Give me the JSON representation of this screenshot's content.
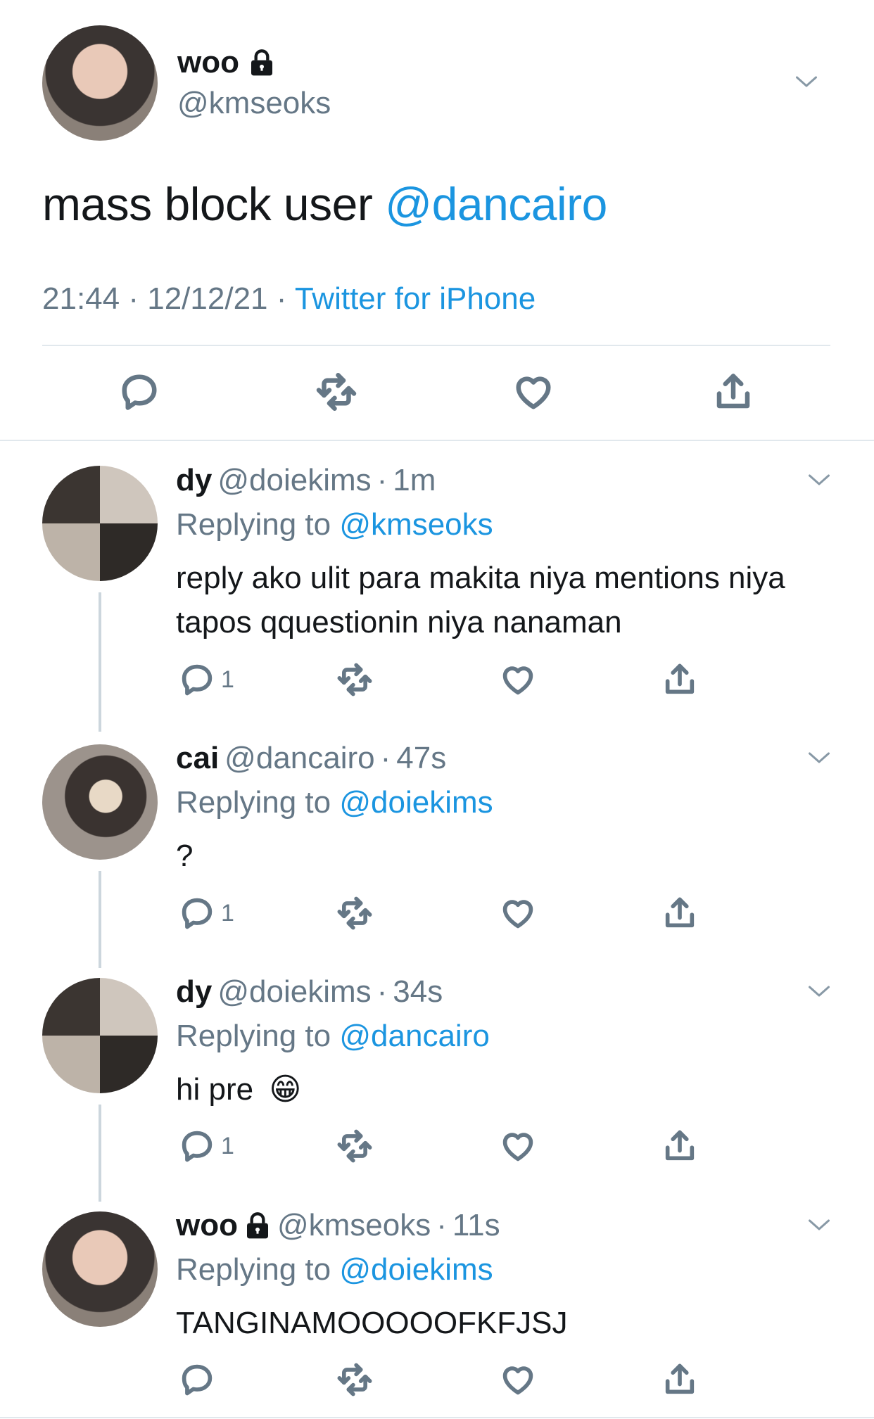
{
  "main_tweet": {
    "author_name": "woo",
    "author_handle": "@kmseoks",
    "text_prefix": "mass block user ",
    "text_mention": "@dancairo",
    "time": "21:44",
    "date": "12/12/21",
    "sep": "·",
    "source": "Twitter for iPhone",
    "avatar_icon": "avatar-photo",
    "lock_icon": "lock-icon"
  },
  "replies": [
    {
      "name": "dy",
      "handle": "@doiekims",
      "sep": "·",
      "time": "1m",
      "replying_prefix": "Replying to",
      "replying_to": "@kmseoks",
      "text": "reply ako ulit para makita niya mentions niya tapos qquestionin niya nanaman",
      "reply_count": "1"
    },
    {
      "name": "cai",
      "handle": "@dancairo",
      "sep": "·",
      "time": "47s",
      "replying_prefix": "Replying to",
      "replying_to": "@doiekims",
      "text": "?",
      "reply_count": "1"
    },
    {
      "name": "dy",
      "handle": "@doiekims",
      "sep": "·",
      "time": "34s",
      "replying_prefix": "Replying to",
      "replying_to": "@dancairo",
      "text": "hi pre",
      "emoji": "😁",
      "reply_count": "1"
    },
    {
      "name": "woo",
      "handle": "@kmseoks",
      "sep": "·",
      "time": "11s",
      "replying_prefix": "Replying to",
      "replying_to": "@doiekims",
      "text": "TANGINAMOOOOOFKFJSJ",
      "reply_count": ""
    }
  ],
  "colors": {
    "link": "#1b95e0",
    "secondary": "#657786",
    "divider": "#e1e8ed"
  }
}
